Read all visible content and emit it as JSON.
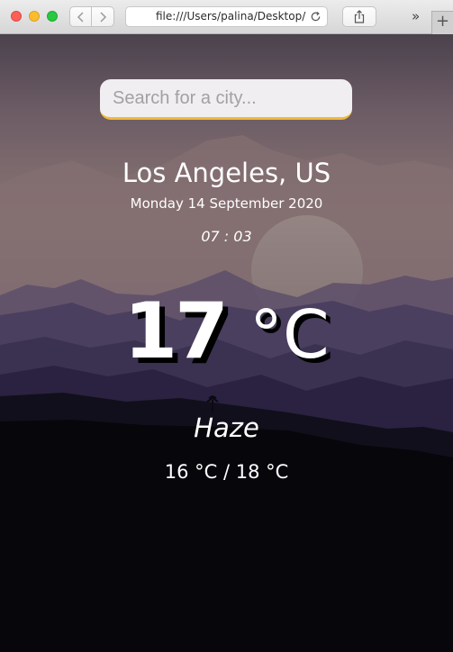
{
  "browser": {
    "url": "file:///Users/palina/Desktop/",
    "overflow_label": "»",
    "new_tab_label": "+"
  },
  "search": {
    "placeholder": "Search for a city..."
  },
  "weather": {
    "location": "Los Angeles, US",
    "date": "Monday 14 September 2020",
    "time": "07 : 03",
    "temperature": "17",
    "temperature_unit": "°C",
    "condition": "Haze",
    "hi_low": "16 °C / 18 °C"
  },
  "colors": {
    "search_accent": "#f0b93a",
    "text": "#ffffff"
  }
}
